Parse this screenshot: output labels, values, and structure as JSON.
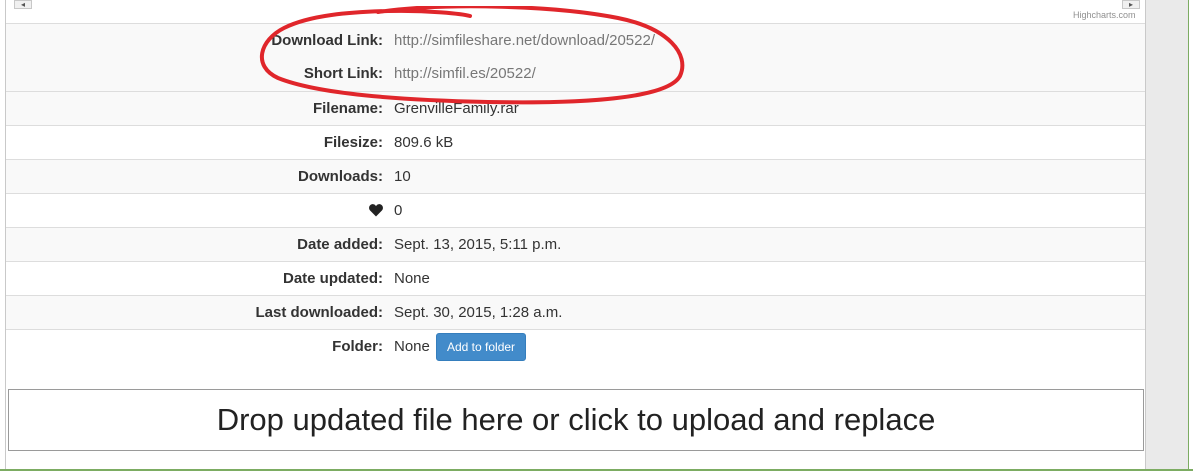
{
  "chart_credit": "Highcharts.com",
  "scrollbar": {
    "left_arrow": "◂",
    "right_arrow": "▸"
  },
  "rows": [
    {
      "label": "Download Link:",
      "value": "http://simfileshare.net/download/20522/"
    },
    {
      "label": "Short Link:",
      "value": "http://simfil.es/20522/"
    },
    {
      "label": "Filename:",
      "value": "GrenvilleFamily.rar"
    },
    {
      "label": "Filesize:",
      "value": "809.6 kB"
    },
    {
      "label": "Downloads:",
      "value": "10"
    },
    {
      "label_icon": "heart-icon",
      "value": "0"
    },
    {
      "label": "Date added:",
      "value": "Sept. 13, 2015, 5:11 p.m."
    },
    {
      "label": "Date updated:",
      "value": "None"
    },
    {
      "label": "Last downloaded:",
      "value": "Sept. 30, 2015, 1:28 a.m."
    },
    {
      "label": "Folder:",
      "value": "None"
    }
  ],
  "folder_button": "Add to folder",
  "dropzone_text": "Drop updated file here or click to upload and replace",
  "colors": {
    "button_blue": "#428bca",
    "annotation_red": "#e0262b",
    "link_grey": "#777777",
    "frame_green": "#7cac62"
  }
}
